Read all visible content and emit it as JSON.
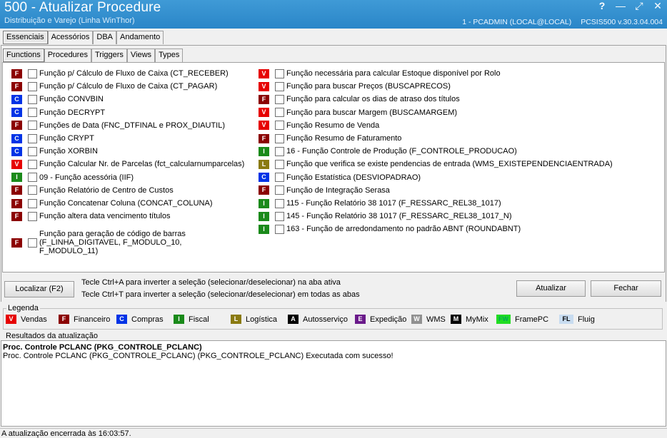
{
  "window": {
    "title": "500 - Atualizar Procedure",
    "subtitle": "Distribuição e Varejo (Linha WinThor)",
    "user": "1 - PCADMIN (LOCAL@LOCAL)",
    "version": "PCSIS500  v.30.3.04.004",
    "help": "?",
    "minimize": "—",
    "maximize": "⤢",
    "close": "✕"
  },
  "main_tabs": [
    "Essenciais",
    "Acessórios",
    "DBA",
    "Andamento"
  ],
  "sub_tabs": [
    "Functions",
    "Procedures",
    "Triggers",
    "Views",
    "Types"
  ],
  "colors": {
    "V": "#e60000",
    "F": "#8b0000",
    "C": "#0033e6",
    "I": "#1a8a1a",
    "L": "#8a7a10",
    "A": "#000000",
    "E": "#6a1a8a",
    "W": "#909090",
    "M": "#000000",
    "FW": "#22dd22",
    "FL": "#c8dcf0"
  },
  "left_functions": [
    {
      "badge": "F",
      "label": "Função p/ Cálculo de Fluxo de Caixa (CT_RECEBER)"
    },
    {
      "badge": "F",
      "label": "Função p/ Cálculo de Fluxo de Caixa (CT_PAGAR)"
    },
    {
      "badge": "C",
      "label": "Função CONVBIN"
    },
    {
      "badge": "C",
      "label": "Função DECRYPT"
    },
    {
      "badge": "F",
      "label": "Funções de Data (FNC_DTFINAL e PROX_DIAUTIL)"
    },
    {
      "badge": "C",
      "label": "Função CRYPT"
    },
    {
      "badge": "C",
      "label": "Função XORBIN"
    },
    {
      "badge": "V",
      "label": "Função Calcular Nr. de Parcelas (fct_calcularnumparcelas)"
    },
    {
      "badge": "I",
      "label": "09 - Função acessória (IIF)"
    },
    {
      "badge": "F",
      "label": "Função Relatório de Centro de Custos"
    },
    {
      "badge": "F",
      "label": "Função Concatenar Coluna (CONCAT_COLUNA)"
    },
    {
      "badge": "F",
      "label": "Função altera data vencimento títulos"
    },
    {
      "badge": "F",
      "label": "Função para geração de código de barras (F_LINHA_DIGITAVEL, F_MODULO_10, F_MODULO_11)"
    }
  ],
  "right_functions": [
    {
      "badge": "V",
      "label": "Função necessária para calcular Estoque disponível por Rolo"
    },
    {
      "badge": "V",
      "label": "Função para buscar Preços (BUSCAPRECOS)"
    },
    {
      "badge": "F",
      "label": "Função para calcular os dias de atraso dos títulos"
    },
    {
      "badge": "V",
      "label": "Função para buscar Margem (BUSCAMARGEM)"
    },
    {
      "badge": "V",
      "label": "Função Resumo de Venda"
    },
    {
      "badge": "F",
      "label": "Função Resumo de Faturamento"
    },
    {
      "badge": "I",
      "label": "16 - Função Controle de Produção (F_CONTROLE_PRODUCAO)"
    },
    {
      "badge": "L",
      "label": "Função que verifica se existe pendencias de entrada (WMS_EXISTEPENDENCIAENTRADA)"
    },
    {
      "badge": "C",
      "label": "Função Estatística (DESVIOPADRAO)"
    },
    {
      "badge": "F",
      "label": "Função de Integração Serasa"
    },
    {
      "badge": "I",
      "label": "115 - Função Relatório 38 1017 (F_RESSARC_REL38_1017)"
    },
    {
      "badge": "I",
      "label": "145 - Função Relatório 38 1017 (F_RESSARC_REL38_1017_N)"
    },
    {
      "badge": "I",
      "label": "163 - Função de arredondamento no padrão ABNT (ROUNDABNT)"
    }
  ],
  "buttons": {
    "localizar": "Localizar (F2)",
    "atualizar": "Atualizar",
    "fechar": "Fechar"
  },
  "hints": [
    "Tecle Ctrl+A para inverter a seleção (selecionar/deselecionar) na aba ativa",
    "Tecle Ctrl+T para inverter a seleção (selecionar/deselecionar) em todas as abas"
  ],
  "legend": {
    "title": "Legenda",
    "items": [
      {
        "badge": "V",
        "label": "Vendas"
      },
      {
        "badge": "F",
        "label": "Financeiro"
      },
      {
        "badge": "C",
        "label": "Compras"
      },
      {
        "badge": "I",
        "label": "Fiscal"
      },
      {
        "badge": "L",
        "label": "Logística"
      },
      {
        "badge": "A",
        "label": "Autosserviço"
      },
      {
        "badge": "E",
        "label": "Expedição"
      },
      {
        "badge": "W",
        "label": "WMS"
      },
      {
        "badge": "M",
        "label": "MyMix"
      },
      {
        "badge": "FW",
        "label": "FramePC"
      },
      {
        "badge": "FL",
        "label": "Fluig"
      }
    ]
  },
  "results": {
    "title": "Resultados da atualização",
    "header": "Proc. Controle PCLANC (PKG_CONTROLE_PCLANC)",
    "message": "Proc. Controle PCLANC (PKG_CONTROLE_PCLANC) (PKG_CONTROLE_PCLANC) Executada com sucesso!"
  },
  "status": "A atualização encerrada às 16:03:57."
}
